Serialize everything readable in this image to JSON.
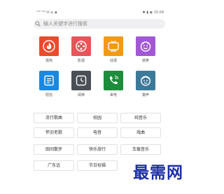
{
  "status_bar": {
    "left": "ᵀ⁴ˡˡ ᵀ⁴ˡˡ ✉ ◎ ▪",
    "right": "✱ ▮ ◉ 15:04"
  },
  "search": {
    "placeholder": "输入关键字进行搜索"
  },
  "categories": [
    {
      "label": "猜热",
      "color": "#ec4a2c",
      "icon": "flame-icon"
    },
    {
      "label": "影视",
      "color": "#e65558",
      "icon": "film-reel-icon"
    },
    {
      "label": "动漫",
      "color": "#f29a16",
      "icon": "tv-icon"
    },
    {
      "label": "搞笑",
      "color": "#a258d6",
      "icon": "smiley-icon"
    },
    {
      "label": "短信",
      "color": "#1b87de",
      "icon": "message-icon"
    },
    {
      "label": "闹钟",
      "color": "#4a4f56",
      "icon": "alarm-clock-icon"
    },
    {
      "label": "来电",
      "color": "#1d8c3c",
      "icon": "phone-icon"
    },
    {
      "label": "童声",
      "color": "#3d7a99",
      "icon": "child-face-icon"
    }
  ],
  "tags": [
    [
      "流行歌曲",
      "校园",
      "纯音乐"
    ],
    [
      "怀旧老歌",
      "电音",
      "戏曲"
    ],
    [
      "田间散步",
      "快乐旅行",
      "车载音乐"
    ],
    [
      "广东话",
      "节日祝福",
      ""
    ]
  ],
  "watermark": "最需网"
}
